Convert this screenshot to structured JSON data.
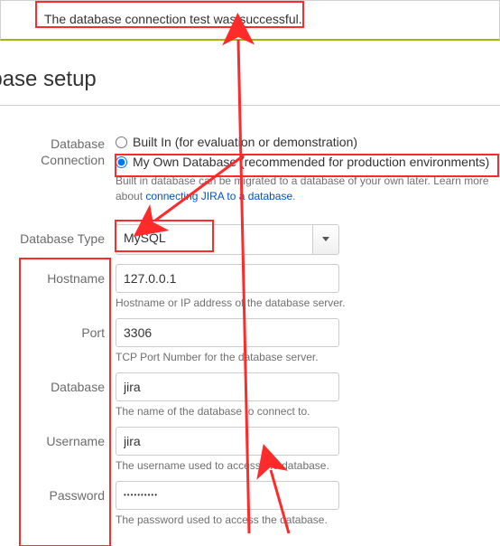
{
  "notification": {
    "message": "The database connection test was successful."
  },
  "page": {
    "title": "abase setup"
  },
  "form": {
    "connection": {
      "label_top": "Database",
      "label_bottom": "Connection",
      "builtin": {
        "label": "Built In (for evaluation or demonstration)",
        "checked": false
      },
      "own": {
        "label": "My Own Database (recommended for production environments)",
        "checked": true
      },
      "hint_prefix": "Built in database can be migrated to a database of your own later. Learn more about ",
      "hint_link": "connecting JIRA to a database",
      "hint_suffix": "."
    },
    "dbtype": {
      "label": "Database Type",
      "value": "MySQL"
    },
    "hostname": {
      "label": "Hostname",
      "value": "127.0.0.1",
      "hint": "Hostname or IP address of the database server."
    },
    "port": {
      "label": "Port",
      "value": "3306",
      "hint": "TCP Port Number for the database server."
    },
    "database": {
      "label": "Database",
      "value": "jira",
      "hint": "The name of the database to connect to."
    },
    "username": {
      "label": "Username",
      "value": "jira",
      "hint": "The username used to access the database."
    },
    "password": {
      "label": "Password",
      "value": "••••••••••",
      "hint": "The password used to access the database."
    }
  }
}
